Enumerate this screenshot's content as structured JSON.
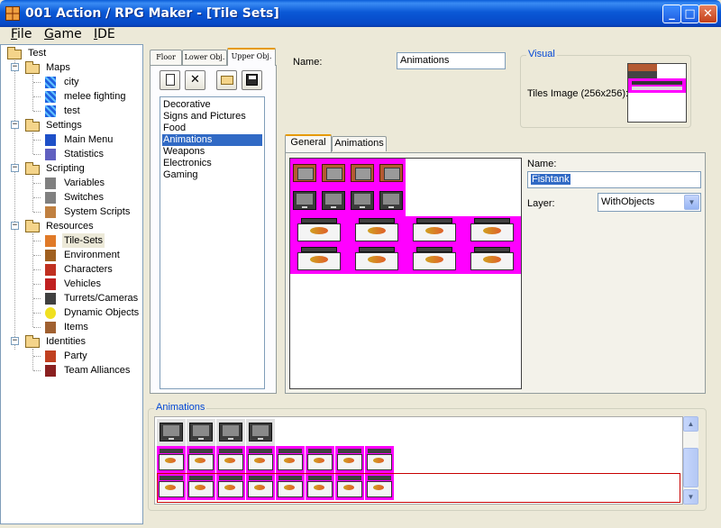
{
  "window": {
    "title": "001 Action / RPG Maker - [Tile Sets]",
    "minimize": "_",
    "maximize": "□",
    "close": "✕"
  },
  "menu": [
    {
      "label": "File",
      "u": "F",
      "rest": "ile"
    },
    {
      "label": "Game",
      "u": "G",
      "rest": "ame"
    },
    {
      "label": "IDE",
      "u": "I",
      "rest": "DE"
    }
  ],
  "tree": {
    "root": "Test",
    "items": [
      {
        "label": "Maps",
        "icon": "folder-icon"
      },
      {
        "label": "city",
        "icon": "map-icon"
      },
      {
        "label": "melee fighting",
        "icon": "map-icon"
      },
      {
        "label": "test",
        "icon": "map-icon"
      },
      {
        "label": "Settings",
        "icon": "folder-icon"
      },
      {
        "label": "Main Menu",
        "icon": "menu-icon"
      },
      {
        "label": "Statistics",
        "icon": "statistics-icon"
      },
      {
        "label": "Scripting",
        "icon": "folder-icon"
      },
      {
        "label": "Variables",
        "icon": "variables-icon"
      },
      {
        "label": "Switches",
        "icon": "switches-icon"
      },
      {
        "label": "System Scripts",
        "icon": "system-scripts-icon"
      },
      {
        "label": "Resources",
        "icon": "folder-icon"
      },
      {
        "label": "Tile-Sets",
        "icon": "tile-sets-icon"
      },
      {
        "label": "Environment",
        "icon": "environment-icon"
      },
      {
        "label": "Characters",
        "icon": "characters-icon"
      },
      {
        "label": "Vehicles",
        "icon": "vehicles-icon"
      },
      {
        "label": "Turrets/Cameras",
        "icon": "turrets-icon"
      },
      {
        "label": "Dynamic Objects",
        "icon": "dynamic-objects-icon"
      },
      {
        "label": "Items",
        "icon": "items-icon"
      },
      {
        "label": "Identities",
        "icon": "folder-icon"
      },
      {
        "label": "Party",
        "icon": "party-icon"
      },
      {
        "label": "Team Alliances",
        "icon": "team-alliances-icon"
      }
    ]
  },
  "tileset_tabs": [
    "Floor",
    "Lower Obj.",
    "Upper Obj."
  ],
  "toolbar": {
    "new": "new-icon",
    "delete": "delete-icon",
    "open": "open-folder-icon",
    "save": "save-icon"
  },
  "categories": [
    "Decorative",
    "Signs and Pictures",
    "Food",
    "Animations",
    "Weapons",
    "Electronics",
    "Gaming"
  ],
  "selected_category": "Animations",
  "name_label": "Name:",
  "name_value": "Animations",
  "visual": {
    "title": "Visual",
    "tiles_label": "Tiles Image (256x256):"
  },
  "editor_tabs": [
    "General",
    "Animations"
  ],
  "tile_props": {
    "name_label": "Name:",
    "name_value": "Fishtank",
    "layer_label": "Layer:",
    "layer_value": "WithObjects"
  },
  "animations_group": "Animations",
  "colors": {
    "accent": "#316ac5",
    "magenta": "#ff00ff",
    "group_title": "#0046d5"
  }
}
